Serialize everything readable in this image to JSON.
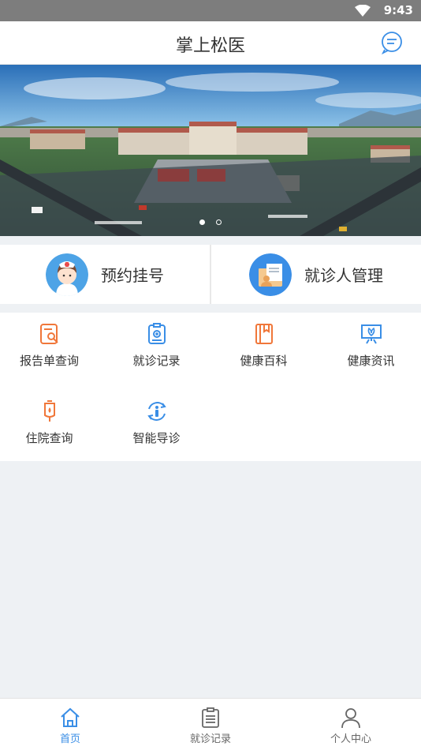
{
  "status_bar": {
    "time": "9:43"
  },
  "header": {
    "title": "掌上松医"
  },
  "banner": {
    "slide_count": 2,
    "active_index": 0
  },
  "quick_actions": [
    {
      "label": "预约挂号",
      "icon": "nurse-avatar-icon"
    },
    {
      "label": "就诊人管理",
      "icon": "patient-folder-icon"
    }
  ],
  "services": [
    {
      "label": "报告单查询",
      "icon": "report-search-icon"
    },
    {
      "label": "就诊记录",
      "icon": "visit-record-icon"
    },
    {
      "label": "健康百科",
      "icon": "health-book-icon"
    },
    {
      "label": "健康资讯",
      "icon": "health-news-icon"
    },
    {
      "label": "住院查询",
      "icon": "hospital-drip-icon"
    },
    {
      "label": "智能导诊",
      "icon": "smart-guide-icon"
    }
  ],
  "tabbar": [
    {
      "label": "首页",
      "icon": "home-icon",
      "active": true
    },
    {
      "label": "就诊记录",
      "icon": "clipboard-icon",
      "active": false
    },
    {
      "label": "个人中心",
      "icon": "user-icon",
      "active": false
    }
  ],
  "colors": {
    "accent": "#3a8ee6",
    "orange": "#f0773a",
    "status_bar": "#7d7d7d",
    "page_bg": "#eef1f4"
  }
}
